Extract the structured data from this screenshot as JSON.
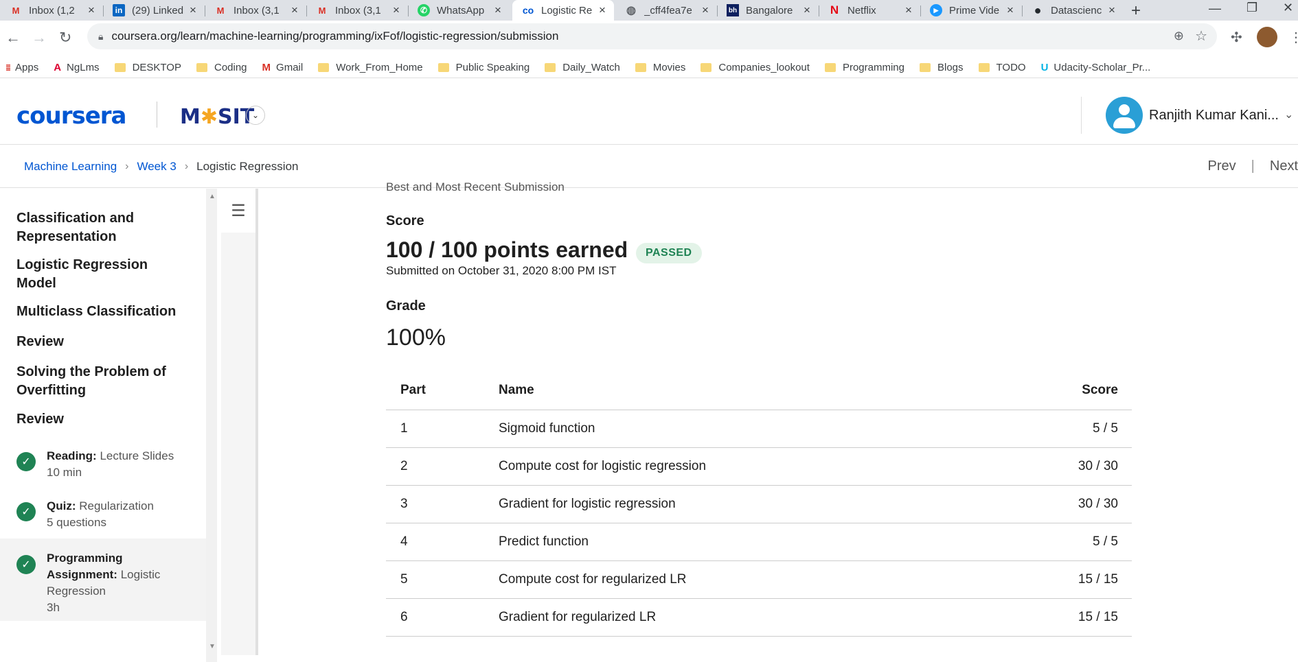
{
  "browser": {
    "tabs": [
      {
        "title": "Inbox (1,2",
        "icon": "gmail-icon",
        "glyph": "M",
        "color": "#d93025"
      },
      {
        "title": "(29) Linked",
        "icon": "linkedin-icon",
        "glyph": "in",
        "color": "#0a66c2"
      },
      {
        "title": "Inbox (3,1",
        "icon": "gmail-icon",
        "glyph": "M",
        "color": "#d93025"
      },
      {
        "title": "Inbox (3,1",
        "icon": "gmail-icon",
        "glyph": "M",
        "color": "#d93025"
      },
      {
        "title": "WhatsApp",
        "icon": "whatsapp-icon",
        "glyph": "✆",
        "color": "#25d366"
      },
      {
        "title": "Logistic Re",
        "icon": "coursera-icon",
        "glyph": "co",
        "color": "#0056d2"
      },
      {
        "title": "_cff4fea7e",
        "icon": "globe-icon",
        "glyph": "◍",
        "color": "#5f6368"
      },
      {
        "title": "Bangalore",
        "icon": "bh-icon",
        "glyph": "bh",
        "color": "#0c1f5e"
      },
      {
        "title": "Netflix",
        "icon": "netflix-icon",
        "glyph": "N",
        "color": "#e50914"
      },
      {
        "title": "Prime Vide",
        "icon": "prime-video-icon",
        "glyph": "▶",
        "color": "#1a98ff"
      },
      {
        "title": "Datascienc",
        "icon": "github-icon",
        "glyph": "●",
        "color": "#24292e"
      }
    ],
    "url": "coursera.org/learn/machine-learning/programming/ixFof/logistic-regression/submission",
    "bookmarks": [
      {
        "label": "Apps",
        "icon": "apps-grid-icon",
        "glyph": "⋮⋮⋮",
        "color": "#d93025"
      },
      {
        "label": "NgLms",
        "icon": "angular-icon",
        "glyph": "A",
        "color": "#dd0031"
      },
      {
        "label": "DESKTOP",
        "icon": "folder-icon"
      },
      {
        "label": "Coding",
        "icon": "folder-icon"
      },
      {
        "label": "Gmail",
        "icon": "gmail-icon",
        "glyph": "M",
        "color": "#d93025"
      },
      {
        "label": "Work_From_Home",
        "icon": "folder-icon"
      },
      {
        "label": "Public Speaking",
        "icon": "folder-icon"
      },
      {
        "label": "Daily_Watch",
        "icon": "folder-icon"
      },
      {
        "label": "Movies",
        "icon": "folder-icon"
      },
      {
        "label": "Companies_lookout",
        "icon": "folder-icon"
      },
      {
        "label": "Programming",
        "icon": "folder-icon"
      },
      {
        "label": "Blogs",
        "icon": "folder-icon"
      },
      {
        "label": "TODO",
        "icon": "folder-icon"
      },
      {
        "label": "Udacity-Scholar_Pr...",
        "icon": "udacity-icon",
        "glyph": "U",
        "color": "#02b3e4"
      }
    ]
  },
  "header": {
    "logo": "coursera",
    "org_logo_prefix": "M",
    "org_logo_suffix": "SIT",
    "user_name": "Ranjith Kumar Kani..."
  },
  "breadcrumb": {
    "course": "Machine Learning",
    "week": "Week 3",
    "current": "Logistic Regression",
    "prev": "Prev",
    "next": "Next"
  },
  "sidebar": {
    "sections": [
      "Classification and Representation",
      "Logistic Regression Model",
      "Multiclass Classification",
      "Review",
      "Solving the Problem of Overfitting",
      "Review"
    ],
    "items": [
      {
        "type": "Reading:",
        "title": "Lecture Slides",
        "meta": "10 min"
      },
      {
        "type": "Quiz:",
        "title": "Regularization",
        "meta": "5 questions"
      },
      {
        "type": "Programming Assignment:",
        "title": "Logistic Regression",
        "meta": "3h"
      }
    ]
  },
  "main": {
    "cut_text": "Best and Most Recent Submission",
    "score_label": "Score",
    "points": "100 / 100 points earned",
    "status": "PASSED",
    "submitted": "Submitted on October 31, 2020 8:00 PM IST",
    "grade_label": "Grade",
    "grade": "100%",
    "table": {
      "headers": [
        "Part",
        "Name",
        "Score"
      ],
      "rows": [
        [
          "1",
          "Sigmoid function",
          "5 / 5"
        ],
        [
          "2",
          "Compute cost for logistic regression",
          "30 / 30"
        ],
        [
          "3",
          "Gradient for logistic regression",
          "30 / 30"
        ],
        [
          "4",
          "Predict function",
          "5 / 5"
        ],
        [
          "5",
          "Compute cost for regularized LR",
          "15 / 15"
        ],
        [
          "6",
          "Gradient for regularized LR",
          "15 / 15"
        ]
      ]
    }
  }
}
